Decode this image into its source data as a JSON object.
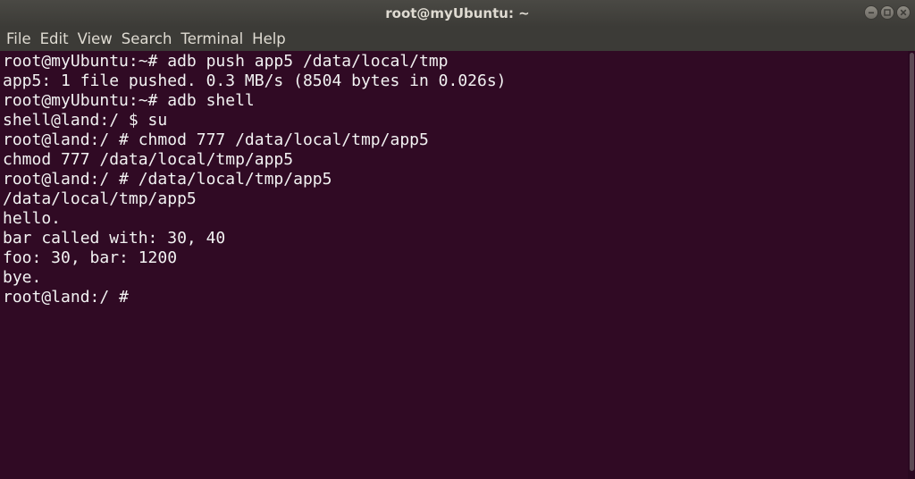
{
  "window": {
    "title": "root@myUbuntu: ~"
  },
  "menu": {
    "items": [
      "File",
      "Edit",
      "View",
      "Search",
      "Terminal",
      "Help"
    ]
  },
  "terminal": {
    "lines": [
      "root@myUbuntu:~# adb push app5 /data/local/tmp",
      "app5: 1 file pushed. 0.3 MB/s (8504 bytes in 0.026s)",
      "root@myUbuntu:~# adb shell",
      "shell@land:/ $ su",
      "root@land:/ # chmod 777 /data/local/tmp/app5",
      "chmod 777 /data/local/tmp/app5",
      "root@land:/ # /data/local/tmp/app5",
      "/data/local/tmp/app5",
      "hello.",
      "bar called with: 30, 40",
      "foo: 30, bar: 1200",
      "bye.",
      "root@land:/ # "
    ]
  },
  "colors": {
    "terminal_background": "#300a24",
    "terminal_text": "#f2f2f2",
    "titlebar": "#3c3b37"
  },
  "icons": {
    "minimize": "minimize-icon",
    "maximize": "maximize-icon",
    "close": "close-icon"
  }
}
